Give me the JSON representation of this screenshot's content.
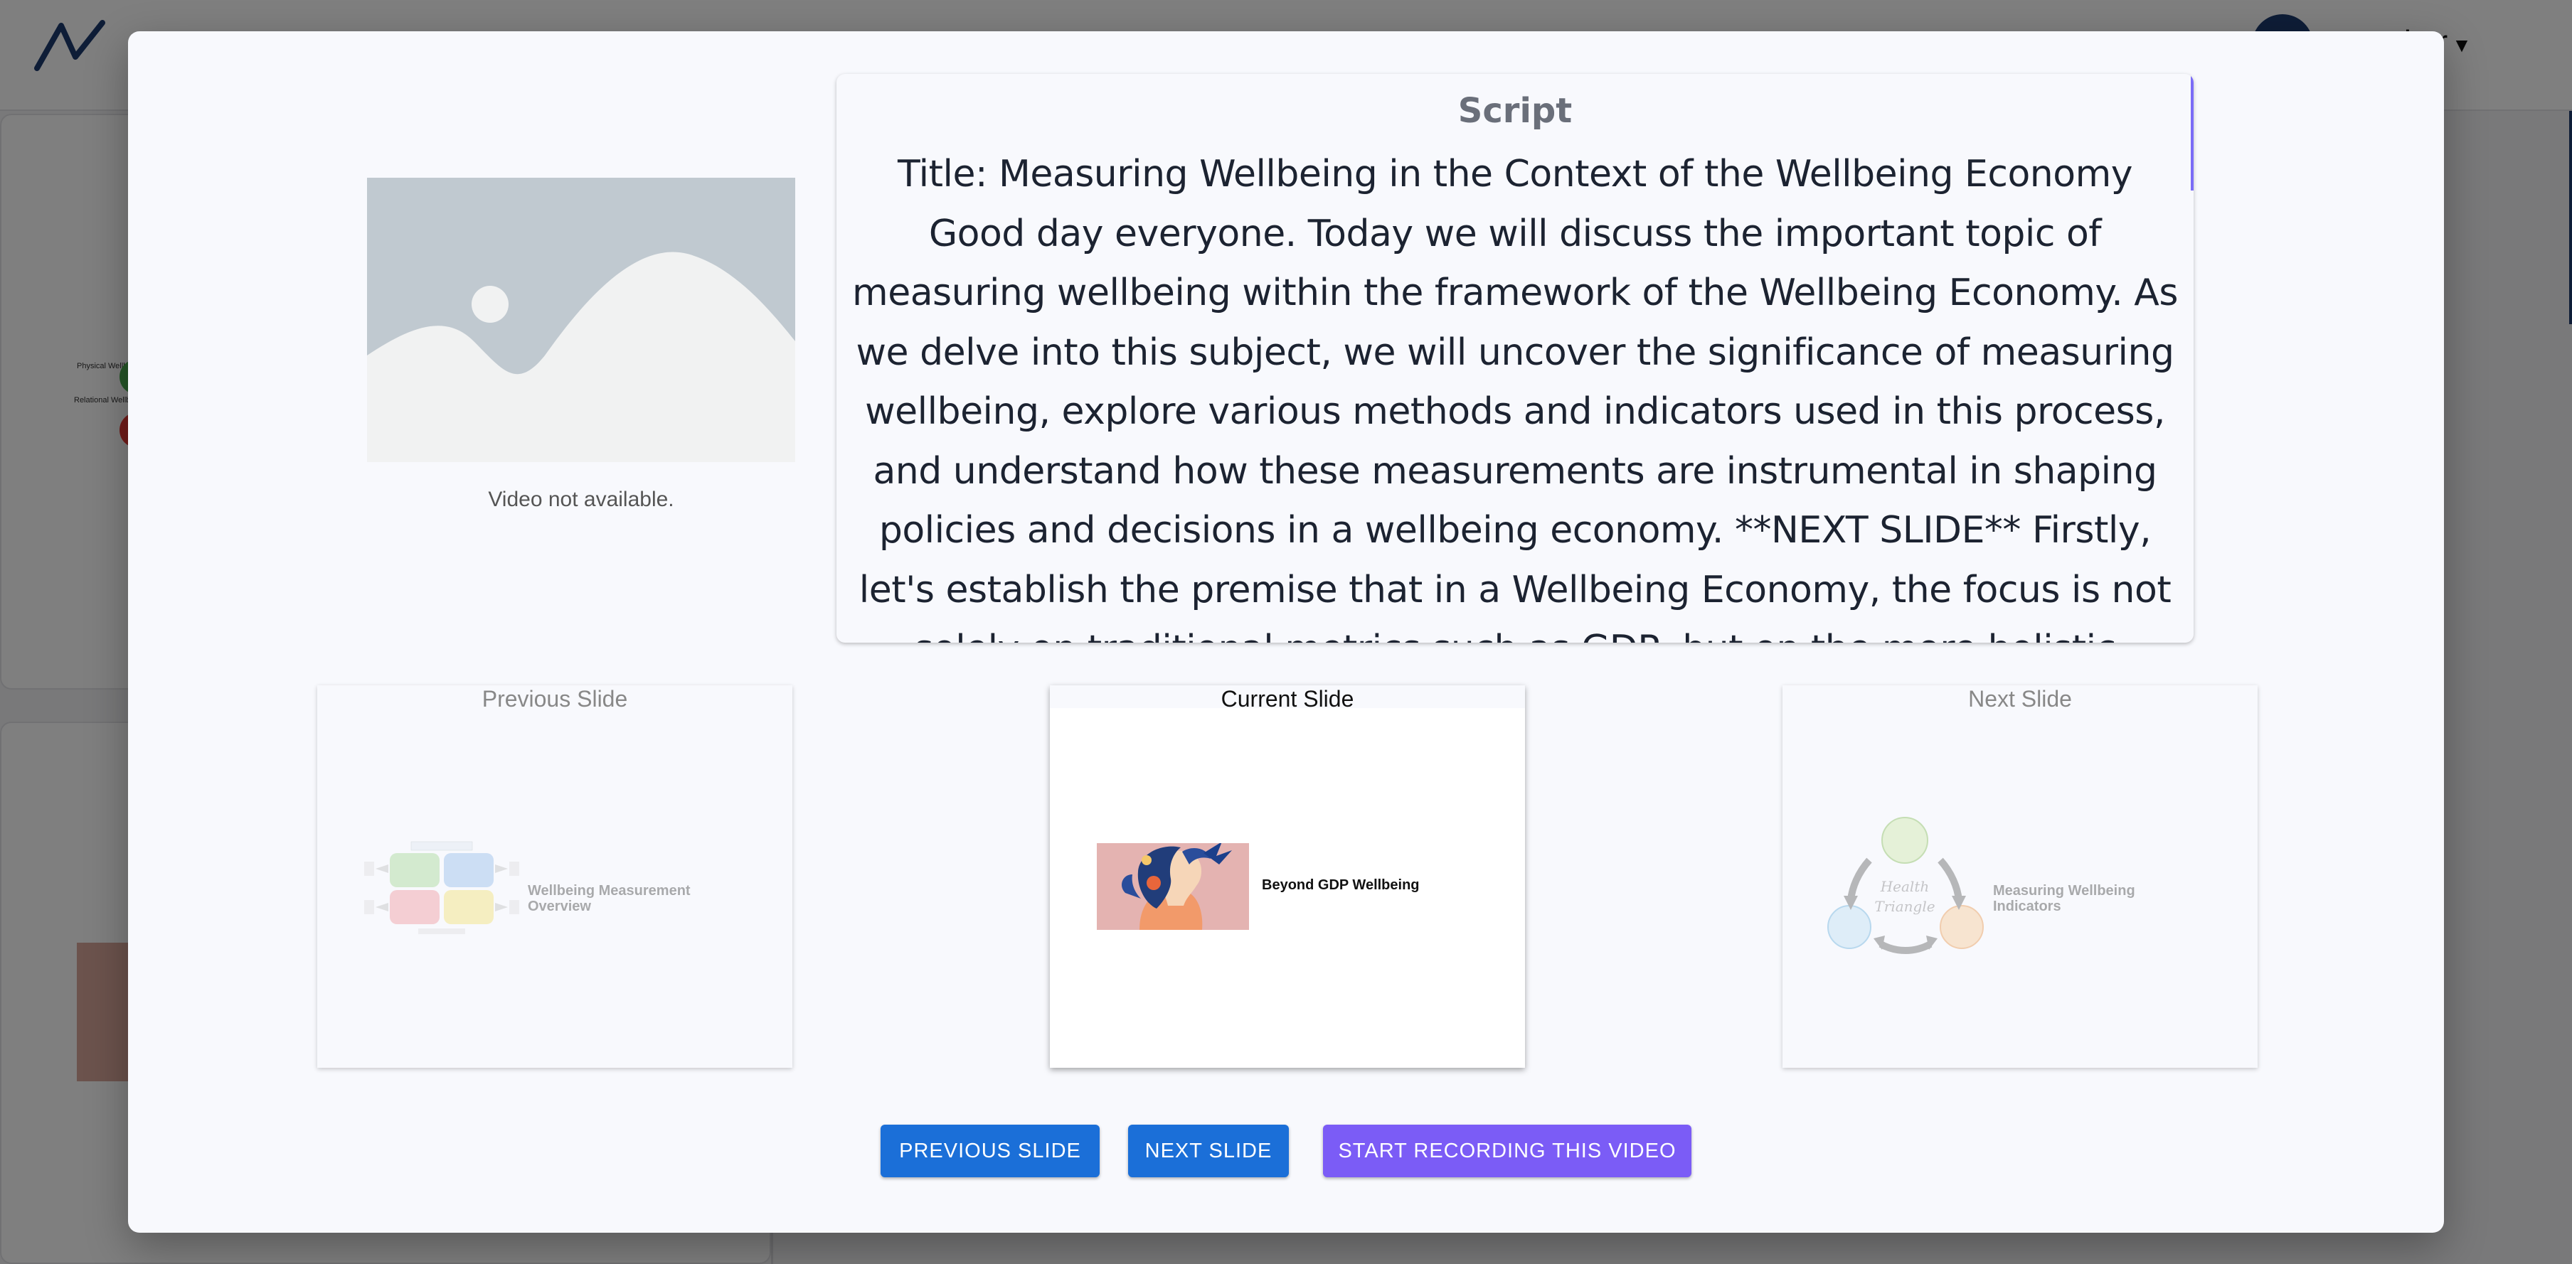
{
  "background": {
    "user_name_partial": "ker",
    "thumb_labels": [
      "Physical Wellbeing",
      "Relational Wellbeing"
    ]
  },
  "modal": {
    "video": {
      "caption": "Video not available."
    },
    "script": {
      "title": "Script",
      "text": "Title: Measuring Wellbeing in the Context of the Wellbeing Economy Good day everyone. Today we will discuss the important topic of measuring wellbeing within the framework of the Wellbeing Economy. As we delve into this subject, we will uncover the significance of measuring wellbeing, explore various methods and indicators used in this process, and understand how these measurements are instrumental in shaping policies and decisions in a wellbeing economy. **NEXT SLIDE** Firstly, let's establish the premise that in a Wellbeing Economy, the focus is not solely on traditional metrics such as GDP, but on the more holistic wellbeing of"
    },
    "slides": {
      "previous": {
        "label": "Previous Slide",
        "title": "Wellbeing Measurement Overview"
      },
      "current": {
        "label": "Current Slide",
        "title": "Beyond GDP Wellbeing"
      },
      "next": {
        "label": "Next Slide",
        "title": "Measuring Wellbeing Indicators",
        "diagram_text": "Health Triangle"
      }
    },
    "buttons": {
      "previous": "PREVIOUS SLIDE",
      "next": "NEXT SLIDE",
      "record": "START RECORDING THIS VIDEO"
    }
  },
  "colors": {
    "primary": "#1b6fd8",
    "accent": "#7b5cf6",
    "script_text": "#1c2331",
    "modal_bg": "#f8f9fd"
  }
}
